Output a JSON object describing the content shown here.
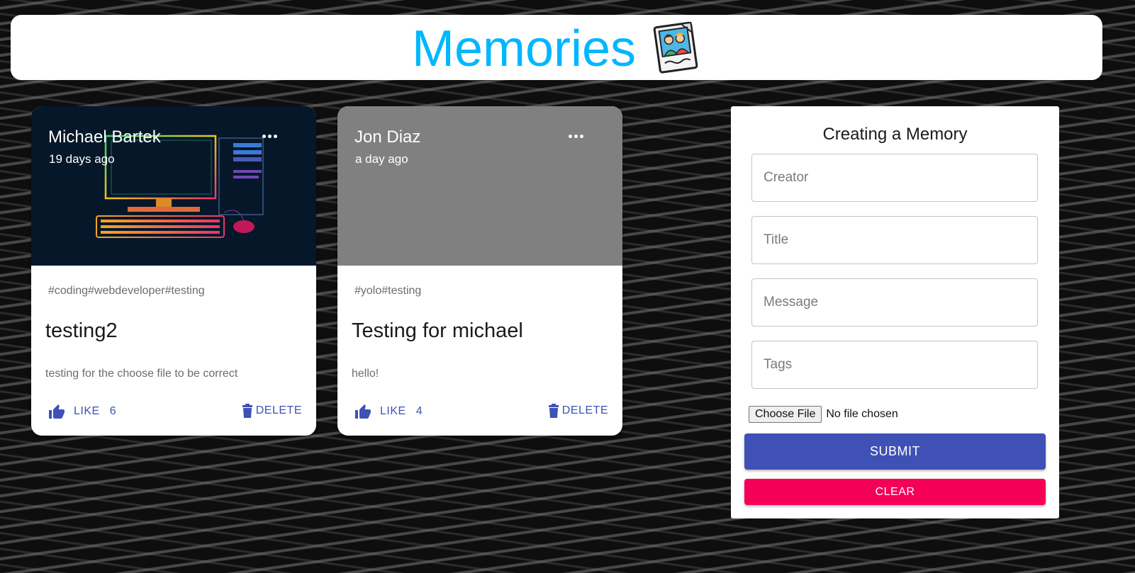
{
  "app": {
    "title": "Memories",
    "logo_icon": "photo-memories-icon",
    "title_color": "#00b7ff"
  },
  "posts": [
    {
      "creator": "Michael Bartek",
      "time_ago": "19 days ago",
      "tags": "#coding#webdeveloper#testing",
      "title": "testing2",
      "message": "testing for the choose file to be correct",
      "like_label": "LIKE",
      "like_count": "6",
      "delete_label": "DELETE",
      "media": "computer-illustration"
    },
    {
      "creator": "Jon Diaz",
      "time_ago": "a day ago",
      "tags": "#yolo#testing",
      "title": "Testing for michael",
      "message": "hello!",
      "like_label": "LIKE",
      "like_count": "4",
      "delete_label": "DELETE",
      "media": "gray-placeholder"
    }
  ],
  "form": {
    "heading": "Creating a Memory",
    "creator_placeholder": "Creator",
    "title_placeholder": "Title",
    "message_placeholder": "Message",
    "tags_placeholder": "Tags",
    "choose_file_label": "Choose File",
    "no_file_text": "No file chosen",
    "submit_label": "SUBMIT",
    "clear_label": "CLEAR"
  },
  "colors": {
    "primary": "#3f51b5",
    "secondary": "#f50057"
  }
}
